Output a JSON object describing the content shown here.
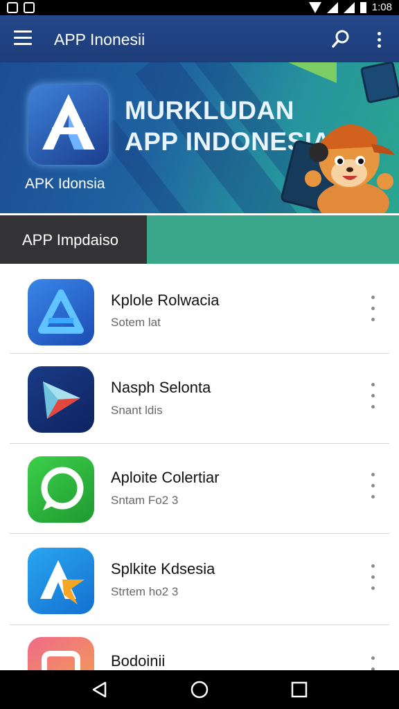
{
  "status_bar": {
    "time": "1:08"
  },
  "app_bar": {
    "title": "APP Inonesii"
  },
  "banner": {
    "headline_line1": "MURKLUDAN",
    "headline_line2": "APP INDONESIA",
    "logo_caption": "APK Idonsia"
  },
  "section": {
    "tab_label": "APP Impdaiso"
  },
  "apps": [
    {
      "name": "Kplole Rolwacia",
      "subtitle": "Sotem lat",
      "icon": "blue-triangle-a-icon",
      "color": "#2b64c8"
    },
    {
      "name": "Nasph Selonta",
      "subtitle": "Snant ldis",
      "icon": "play-store-icon",
      "color": "#123074"
    },
    {
      "name": "Aploite Colertiar",
      "subtitle": "Sntam Fo2 3",
      "icon": "chat-bubble-icon",
      "color": "#23a53b"
    },
    {
      "name": "Splkite Kdsesia",
      "subtitle": "Strtem ho2 3",
      "icon": "star-a-icon",
      "color": "#1f8de0"
    },
    {
      "name": "Bodoinii",
      "subtitle": "",
      "icon": "gift-box-icon",
      "color": "#e9457c"
    }
  ],
  "colors": {
    "app_bar": "#1d3c78",
    "accent_teal": "#3aa78a",
    "section_tab": "#333335"
  }
}
